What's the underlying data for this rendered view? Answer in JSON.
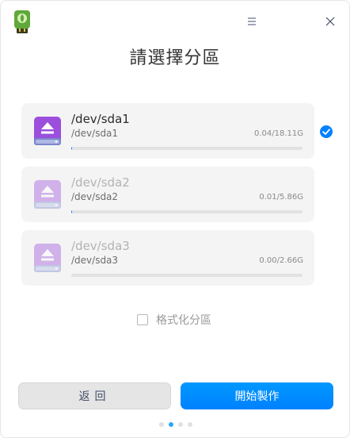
{
  "window": {
    "title": "請選擇分區",
    "icons": {
      "logo": "usb-drive-logo-icon",
      "menu": "menu-icon",
      "close": "close-icon"
    }
  },
  "partitions": [
    {
      "name": "/dev/sda1",
      "device": "/dev/sda1",
      "size": "0.04/18.11G",
      "usage": 0.002,
      "selected": true,
      "icon": "usb-disk-icon"
    },
    {
      "name": "/dev/sda2",
      "device": "/dev/sda2",
      "size": "0.01/5.86G",
      "usage": 0.002,
      "selected": false,
      "icon": "usb-disk-icon"
    },
    {
      "name": "/dev/sda3",
      "device": "/dev/sda3",
      "size": "0.00/2.66G",
      "usage": 0.0,
      "selected": false,
      "icon": "usb-disk-icon"
    }
  ],
  "format": {
    "label": "格式化分區",
    "checked": false
  },
  "buttons": {
    "back": "返回",
    "start": "開始製作"
  },
  "pager": {
    "count": 4,
    "active_index": 1
  },
  "colors": {
    "accent": "#0081ff",
    "disk_purple": "#9b4fdc",
    "pager_active": "#2ca7f8"
  }
}
